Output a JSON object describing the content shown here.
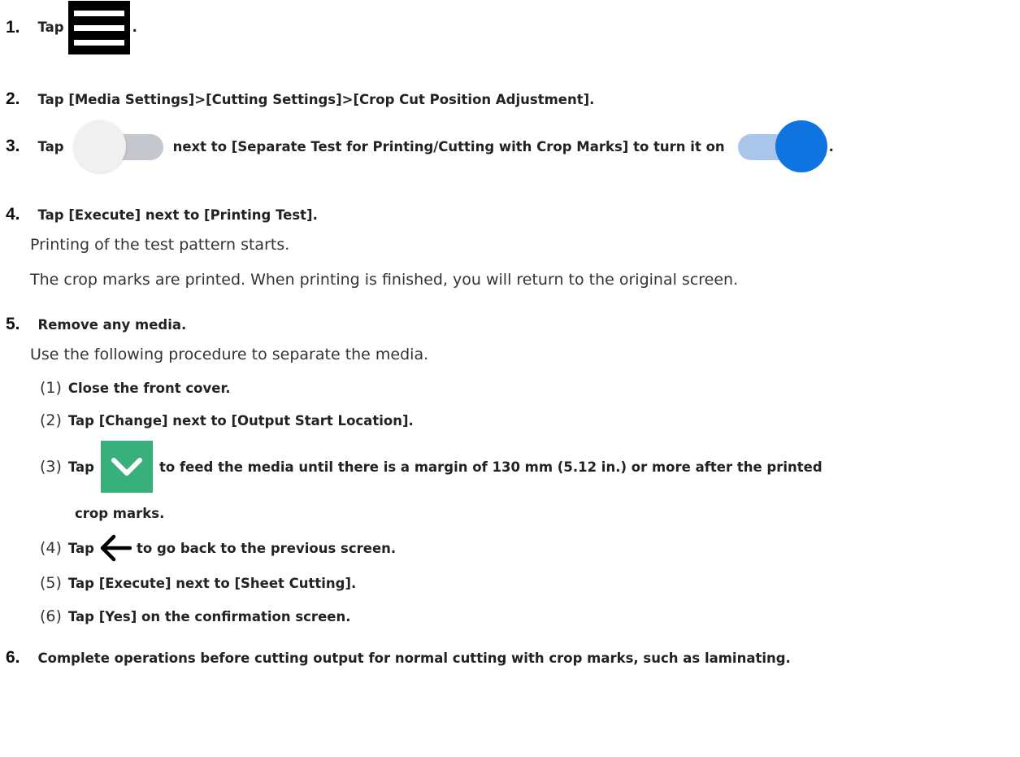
{
  "steps": [
    {
      "num": "1.",
      "t1": "Tap",
      "t2": "."
    },
    {
      "num": "2.",
      "t1": "Tap [Media Settings]>[Cutting Settings]>[Crop Cut Position Adjustment]."
    },
    {
      "num": "3.",
      "t1": "Tap",
      "t2": "next to [Separate Test for Printing/Cutting with Crop Marks] to turn it on",
      "t3": "."
    },
    {
      "num": "4.",
      "t1": "Tap [Execute] next to [Printing Test].",
      "p1": "Printing of the test pattern starts.",
      "p2": "The crop marks are printed. When printing is finished, you will return to the original screen."
    },
    {
      "num": "5.",
      "t1": "Remove any media.",
      "p1": "Use the following procedure to separate the media."
    },
    {
      "num": "6.",
      "t1": "Complete operations before cutting output for normal cutting with crop marks, such as laminating."
    }
  ],
  "substeps": [
    {
      "num": "(1)",
      "t1": "Close the front cover."
    },
    {
      "num": "(2)",
      "t1": "Tap [Change] next to [Output Start Location]."
    },
    {
      "num": "(3)",
      "t1": "Tap",
      "t2": "to feed the media until there is a margin of 130 mm (5.12 in.) or more after the printed",
      "t3": "crop marks."
    },
    {
      "num": "(4)",
      "t1": "Tap",
      "t2": "to go back to the previous screen."
    },
    {
      "num": "(5)",
      "t1": "Tap [Execute] next to [Sheet Cutting]."
    },
    {
      "num": "(6)",
      "t1": "Tap [Yes] on the confirmation screen."
    }
  ],
  "icons": {
    "menu": "menu-icon",
    "toggle_off": "toggle-off-icon",
    "toggle_on": "toggle-on-icon",
    "down": "chevron-down-icon",
    "back": "arrow-left-icon"
  },
  "colors": {
    "toggle_on_knob": "#0f74df",
    "toggle_on_track": "#a9c6ea",
    "toggle_off_track": "#c4c7cc",
    "down_button": "#38b07c"
  }
}
